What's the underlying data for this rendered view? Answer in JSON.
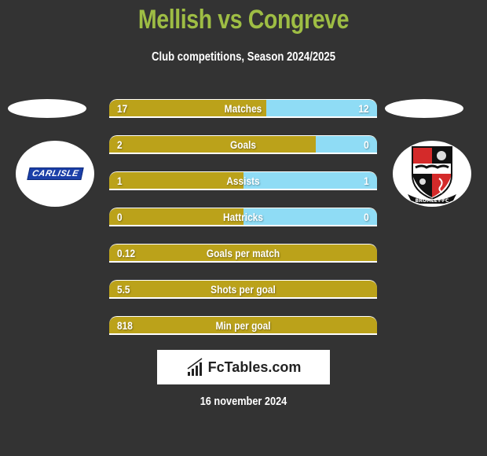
{
  "header": {
    "title": "Mellish vs Congreve",
    "subtitle": "Club competitions, Season 2024/2025"
  },
  "teams": {
    "left": {
      "name": "Carlisle",
      "logo_text": "CARLISLE"
    },
    "right": {
      "name": "Bromley FC",
      "logo_text": "BROMLEY-FC"
    }
  },
  "colors": {
    "left_bar": "#bba21a",
    "right_bar": "#8fdcf5",
    "title": "#9ebd44",
    "background": "#333333"
  },
  "stats": [
    {
      "label": "Matches",
      "left": "17",
      "right": "12",
      "left_share": 0.586
    },
    {
      "label": "Goals",
      "left": "2",
      "right": "0",
      "left_share": 0.77
    },
    {
      "label": "Assists",
      "left": "1",
      "right": "1",
      "left_share": 0.5
    },
    {
      "label": "Hattricks",
      "left": "0",
      "right": "0",
      "left_share": 0.5
    },
    {
      "label": "Goals per match",
      "left": "0.12",
      "right": null,
      "left_share": 1
    },
    {
      "label": "Shots per goal",
      "left": "5.5",
      "right": null,
      "left_share": 1
    },
    {
      "label": "Min per goal",
      "left": "818",
      "right": null,
      "left_share": 1
    }
  ],
  "footer": {
    "brand": "FcTables.com",
    "date": "16 november 2024"
  }
}
